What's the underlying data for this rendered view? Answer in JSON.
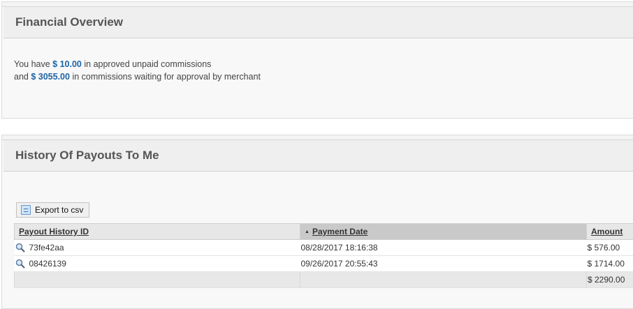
{
  "financial_overview": {
    "title": "Financial Overview",
    "line1_prefix": "You have",
    "approved_amount": "$ 10.00",
    "line1_suffix": "in approved unpaid commissions",
    "line2_prefix": "and",
    "waiting_amount": "$ 3055.00",
    "line2_suffix": "in commissions waiting for approval by merchant"
  },
  "payout_history": {
    "title": "History Of Payouts To Me",
    "export_label": "Export to csv",
    "columns": {
      "id": "Payout History ID",
      "date": "Payment Date",
      "amount": "Amount"
    },
    "rows": [
      {
        "id": "73fe42aa",
        "date": "08/28/2017 18:16:38",
        "amount": "$ 576.00"
      },
      {
        "id": "08426139",
        "date": "09/26/2017 20:55:43",
        "amount": "$ 1714.00"
      }
    ],
    "total_amount": "$ 2290.00"
  },
  "colors": {
    "accent": "#1f64a6",
    "header_bg": "#efefef",
    "sorted_col_bg": "#c9c9c9"
  }
}
